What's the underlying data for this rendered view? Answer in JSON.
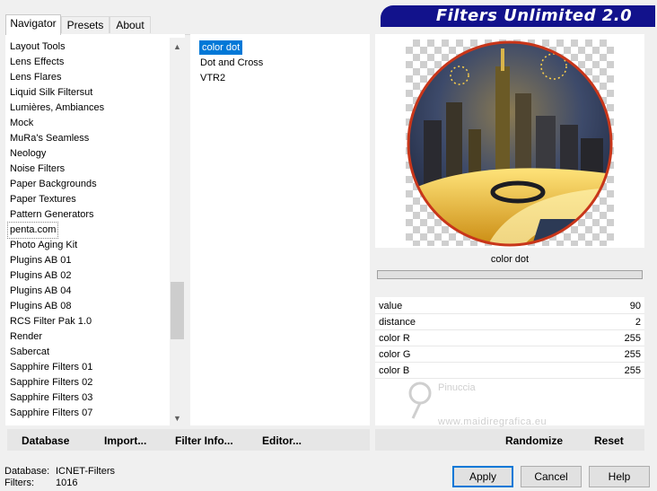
{
  "tabs": [
    {
      "label": "Navigator",
      "active": true
    },
    {
      "label": "Presets",
      "active": false
    },
    {
      "label": "About",
      "active": false
    }
  ],
  "app_title": "Filters Unlimited 2.0",
  "categories": [
    "Layout Tools",
    "Lens Effects",
    "Lens Flares",
    "Liquid Silk Filtersut",
    "Lumières, Ambiances",
    "Mock",
    "MuRa's Seamless",
    "Neology",
    "Noise Filters",
    "Paper Backgrounds",
    "Paper Textures",
    "Pattern Generators",
    "penta.com",
    "Photo Aging Kit",
    "Plugins AB 01",
    "Plugins AB 02",
    "Plugins AB 04",
    "Plugins AB 08",
    "RCS Filter Pak 1.0",
    "Render",
    "Sabercat",
    "Sapphire Filters 01",
    "Sapphire Filters 02",
    "Sapphire Filters 03",
    "Sapphire Filters 07"
  ],
  "selected_category": "penta.com",
  "filters": [
    "color dot",
    "Dot and Cross",
    "VTR2"
  ],
  "selected_filter": "color dot",
  "current_filter_name": "color dot",
  "params": [
    {
      "label": "value",
      "value": "90"
    },
    {
      "label": "distance",
      "value": "2"
    },
    {
      "label": "color R",
      "value": "255"
    },
    {
      "label": "color G",
      "value": "255"
    },
    {
      "label": "color B",
      "value": "255"
    }
  ],
  "watermark": {
    "line1": "Pinuccia",
    "line2": "www.maidiregrafica.eu"
  },
  "left_bar": {
    "database": "Database",
    "import": "Import...",
    "filter_info": "Filter Info...",
    "editor": "Editor..."
  },
  "right_bar": {
    "randomize": "Randomize",
    "reset": "Reset"
  },
  "status": {
    "database_label": "Database:",
    "database_value": "ICNET-Filters",
    "filters_label": "Filters:",
    "filters_value": "1016"
  },
  "buttons": {
    "apply": "Apply",
    "cancel": "Cancel",
    "help": "Help"
  },
  "colors": {
    "banner": "#12128c",
    "selection": "#0078d7",
    "default_button_border": "#0078d7"
  }
}
